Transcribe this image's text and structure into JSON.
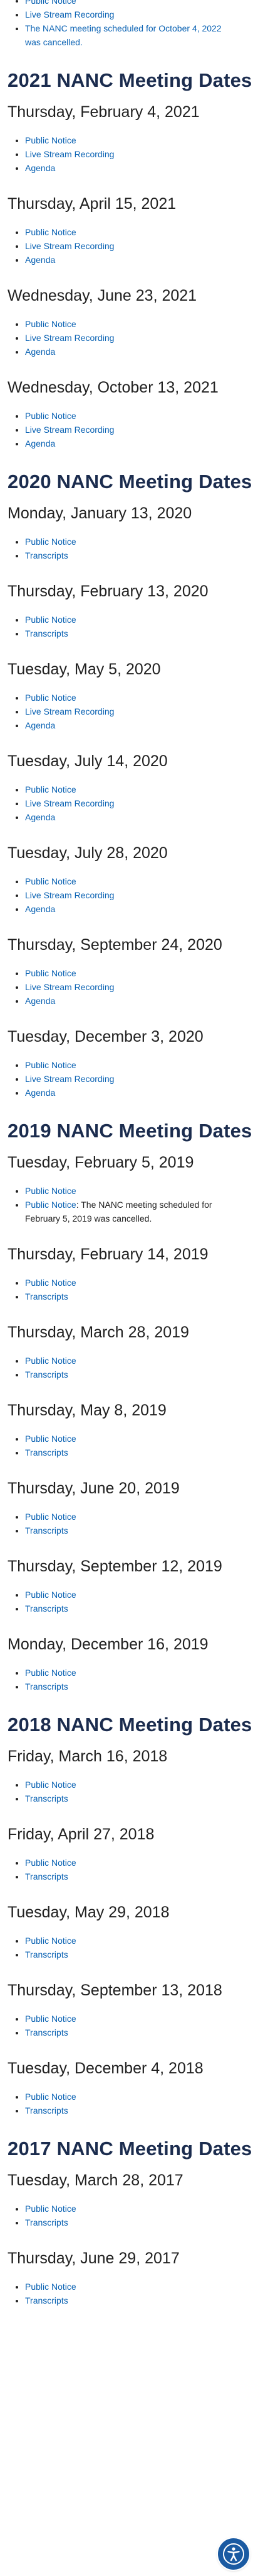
{
  "top_section": {
    "items": [
      {
        "type": "link",
        "label": "Public Notice"
      },
      {
        "type": "link",
        "label": "Live Stream Recording"
      },
      {
        "type": "link",
        "label": "The NANC meeting scheduled for October 4, 2022 was cancelled."
      }
    ]
  },
  "years": [
    {
      "heading": "2021 NANC Meeting Dates",
      "meetings": [
        {
          "date": "Thursday, February 4, 2021",
          "links": [
            "Public Notice",
            "Live Stream Recording",
            "Agenda"
          ]
        },
        {
          "date": "Thursday, April 15, 2021",
          "links": [
            "Public Notice",
            "Live Stream Recording",
            "Agenda"
          ]
        },
        {
          "date": "Wednesday, June 23, 2021",
          "links": [
            "Public Notice",
            "Live Stream Recording",
            "Agenda"
          ]
        },
        {
          "date": "Wednesday, October 13, 2021",
          "links": [
            "Public Notice",
            "Live Stream Recording",
            "Agenda"
          ]
        }
      ]
    },
    {
      "heading": "2020 NANC Meeting Dates",
      "meetings": [
        {
          "date": "Monday, January 13, 2020",
          "links": [
            "Public Notice",
            "Transcripts"
          ]
        },
        {
          "date": "Thursday, February 13, 2020",
          "links": [
            "Public Notice",
            "Transcripts"
          ]
        },
        {
          "date": "Tuesday, May 5, 2020",
          "links": [
            "Public Notice",
            "Live Stream Recording",
            "Agenda"
          ]
        },
        {
          "date": "Tuesday, July 14, 2020",
          "links": [
            "Public Notice",
            "Live Stream Recording",
            "Agenda"
          ]
        },
        {
          "date": "Tuesday, July 28, 2020",
          "links": [
            "Public Notice",
            "Live Stream Recording",
            "Agenda"
          ]
        },
        {
          "date": "Thursday, September 24, 2020",
          "links": [
            "Public Notice",
            "Live Stream Recording",
            "Agenda"
          ]
        },
        {
          "date": "Tuesday, December 3, 2020",
          "links": [
            "Public Notice",
            "Live Stream Recording",
            "Agenda"
          ]
        }
      ]
    },
    {
      "heading": "2019 NANC Meeting Dates",
      "meetings": [
        {
          "date": "Tuesday, February 5, 2019",
          "links": [
            "Public Notice"
          ],
          "note": {
            "link": "Public Notice",
            "text": ": The NANC meeting scheduled for February 5, 2019 was cancelled."
          }
        },
        {
          "date": "Thursday, February 14, 2019",
          "links": [
            "Public Notice",
            "Transcripts"
          ]
        },
        {
          "date": "Thursday, March 28, 2019",
          "links": [
            "Public Notice",
            "Transcripts"
          ]
        },
        {
          "date": "Thursday, May 8, 2019",
          "links": [
            "Public Notice",
            "Transcripts"
          ]
        },
        {
          "date": "Thursday, June 20, 2019",
          "links": [
            "Public Notice",
            "Transcripts"
          ]
        },
        {
          "date": "Thursday, September 12, 2019",
          "links": [
            "Public Notice",
            "Transcripts"
          ]
        },
        {
          "date": "Monday, December 16, 2019",
          "links": [
            "Public Notice",
            "Transcripts"
          ]
        }
      ]
    },
    {
      "heading": "2018 NANC Meeting Dates",
      "meetings": [
        {
          "date": "Friday, March 16, 2018",
          "links": [
            "Public Notice",
            "Transcripts"
          ]
        },
        {
          "date": "Friday, April 27, 2018",
          "links": [
            "Public Notice",
            "Transcripts"
          ]
        },
        {
          "date": "Tuesday, May 29, 2018",
          "links": [
            "Public Notice",
            "Transcripts"
          ]
        },
        {
          "date": "Thursday, September 13, 2018",
          "links": [
            "Public Notice",
            "Transcripts"
          ]
        },
        {
          "date": "Tuesday, December 4, 2018",
          "links": [
            "Public Notice",
            "Transcripts"
          ]
        }
      ]
    },
    {
      "heading": "2017 NANC Meeting Dates",
      "meetings": [
        {
          "date": "Tuesday, March 28, 2017",
          "links": [
            "Public Notice",
            "Transcripts"
          ]
        },
        {
          "date": "Thursday, June 29, 2017",
          "links": [
            "Public Notice",
            "Transcripts"
          ]
        }
      ]
    }
  ],
  "accessibility_button": {
    "icon": "accessibility-icon"
  },
  "colors": {
    "link": "#0a62b3",
    "heading": "#1b2c4e",
    "text": "#212121",
    "a11y_button": "#1a5aa2"
  }
}
